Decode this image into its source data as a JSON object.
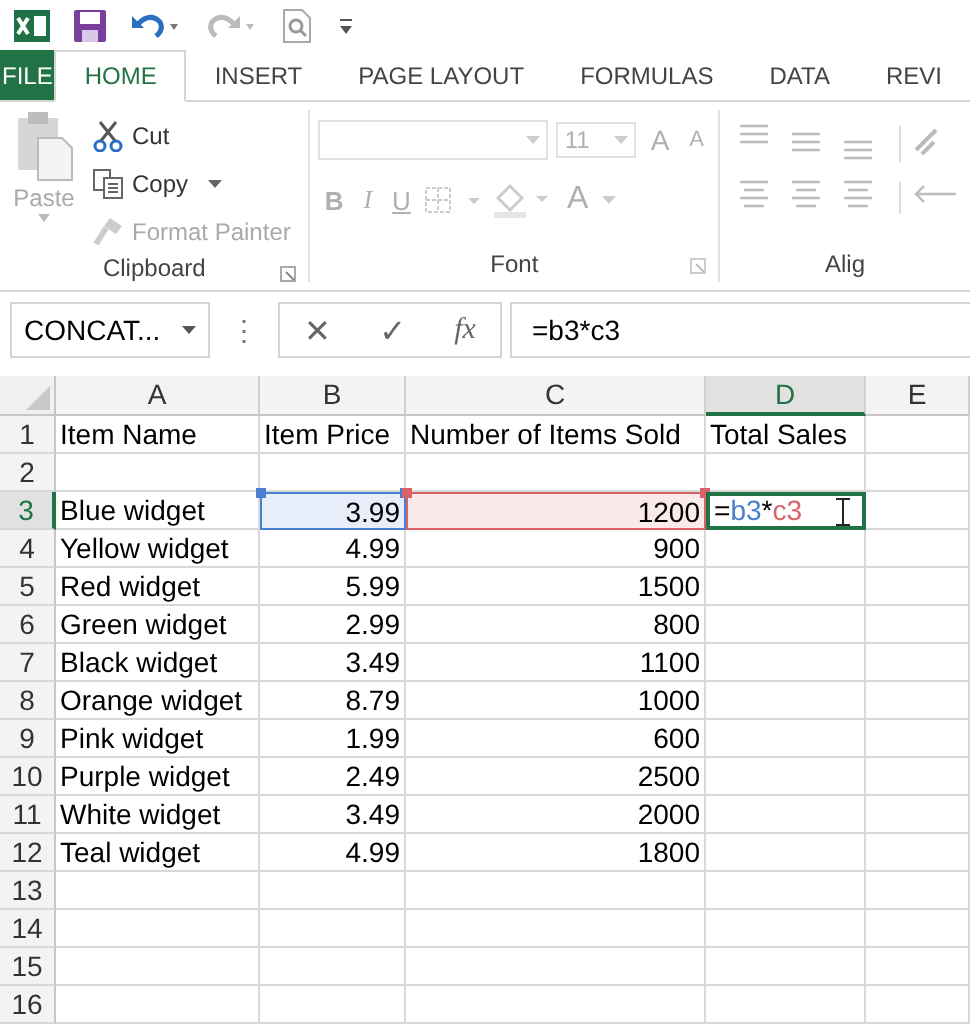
{
  "tabs": [
    {
      "label": "FILE",
      "kind": "file",
      "selected": false
    },
    {
      "label": "HOME",
      "kind": "tab",
      "selected": true
    },
    {
      "label": "INSERT",
      "kind": "tab",
      "selected": false
    },
    {
      "label": "PAGE LAYOUT",
      "kind": "tab",
      "selected": false
    },
    {
      "label": "FORMULAS",
      "kind": "tab",
      "selected": false
    },
    {
      "label": "DATA",
      "kind": "tab",
      "selected": false
    },
    {
      "label": "REVI",
      "kind": "tab",
      "selected": false
    }
  ],
  "ribbon": {
    "clipboard": {
      "title": "Clipboard",
      "paste": {
        "label": "Paste",
        "disabled": true
      },
      "items": [
        {
          "label": "Cut",
          "kind": "cut",
          "disabled": false
        },
        {
          "label": "Copy",
          "kind": "copy",
          "disabled": false
        },
        {
          "label": "Format Painter",
          "kind": "painter",
          "disabled": true
        }
      ]
    },
    "font": {
      "title": "Font",
      "disabled": true,
      "font_size": "11",
      "size_buttons": [
        "A",
        "A"
      ],
      "format_buttons": [
        {
          "label": "B",
          "kind": "bold"
        },
        {
          "label": "I",
          "kind": "italic"
        },
        {
          "label": "U",
          "kind": "underline"
        }
      ],
      "font_color": "A"
    },
    "alignment": {
      "title": "Alig"
    }
  },
  "formula_bar": {
    "name_box": "CONCAT...",
    "separator": "⋮",
    "buttons": [
      "✕",
      "✓",
      "fx"
    ],
    "formula": "=b3*c3"
  },
  "sheet": {
    "columns": [
      {
        "label": "A",
        "selected": false
      },
      {
        "label": "B",
        "selected": false
      },
      {
        "label": "C",
        "selected": false
      },
      {
        "label": "D",
        "selected": true
      },
      {
        "label": "E",
        "selected": false
      }
    ],
    "rows": [
      {
        "number": "1",
        "selected": false,
        "cells": [
          {
            "kind": "text",
            "text": "Item Name"
          },
          {
            "kind": "text",
            "text": "Item Price"
          },
          {
            "kind": "text",
            "text": "Number of Items Sold"
          },
          {
            "kind": "text",
            "text": "Total Sales"
          },
          {
            "kind": "empty"
          }
        ]
      },
      {
        "number": "2",
        "selected": false,
        "cells": [
          {
            "kind": "empty"
          },
          {
            "kind": "empty"
          },
          {
            "kind": "empty"
          },
          {
            "kind": "empty"
          },
          {
            "kind": "empty"
          }
        ]
      },
      {
        "number": "3",
        "selected": true,
        "cells": [
          {
            "kind": "text",
            "text": "Blue widget"
          },
          {
            "kind": "number",
            "text": "3.99",
            "color": "#4a7fd0"
          },
          {
            "kind": "number",
            "text": "1200",
            "color": "#d9626a"
          },
          {
            "kind": "formula",
            "editing": true,
            "parts": [
              {
                "text": "=",
                "color": "#000000"
              },
              {
                "text": "b3",
                "color": "#4a7fd0"
              },
              {
                "text": "*",
                "color": "#000000"
              },
              {
                "text": "c3",
                "color": "#d9626a"
              }
            ]
          },
          {
            "kind": "empty"
          }
        ]
      },
      {
        "number": "4",
        "selected": false,
        "cells": [
          {
            "kind": "text",
            "text": "Yellow widget"
          },
          {
            "kind": "number",
            "text": "4.99"
          },
          {
            "kind": "number",
            "text": "900"
          },
          {
            "kind": "empty"
          },
          {
            "kind": "empty"
          }
        ]
      },
      {
        "number": "5",
        "selected": false,
        "cells": [
          {
            "kind": "text",
            "text": "Red widget"
          },
          {
            "kind": "number",
            "text": "5.99"
          },
          {
            "kind": "number",
            "text": "1500"
          },
          {
            "kind": "empty"
          },
          {
            "kind": "empty"
          }
        ]
      },
      {
        "number": "6",
        "selected": false,
        "cells": [
          {
            "kind": "text",
            "text": "Green widget"
          },
          {
            "kind": "number",
            "text": "2.99"
          },
          {
            "kind": "number",
            "text": "800"
          },
          {
            "kind": "empty"
          },
          {
            "kind": "empty"
          }
        ]
      },
      {
        "number": "7",
        "selected": false,
        "cells": [
          {
            "kind": "text",
            "text": "Black widget"
          },
          {
            "kind": "number",
            "text": "3.49"
          },
          {
            "kind": "number",
            "text": "1100"
          },
          {
            "kind": "empty"
          },
          {
            "kind": "empty"
          }
        ]
      },
      {
        "number": "8",
        "selected": false,
        "cells": [
          {
            "kind": "text",
            "text": "Orange widget"
          },
          {
            "kind": "number",
            "text": "8.79"
          },
          {
            "kind": "number",
            "text": "1000"
          },
          {
            "kind": "empty"
          },
          {
            "kind": "empty"
          }
        ]
      },
      {
        "number": "9",
        "selected": false,
        "cells": [
          {
            "kind": "text",
            "text": "Pink widget"
          },
          {
            "kind": "number",
            "text": "1.99"
          },
          {
            "kind": "number",
            "text": "600"
          },
          {
            "kind": "empty"
          },
          {
            "kind": "empty"
          }
        ]
      },
      {
        "number": "10",
        "selected": false,
        "cells": [
          {
            "kind": "text",
            "text": "Purple widget"
          },
          {
            "kind": "number",
            "text": "2.49"
          },
          {
            "kind": "number",
            "text": "2500"
          },
          {
            "kind": "empty"
          },
          {
            "kind": "empty"
          }
        ]
      },
      {
        "number": "11",
        "selected": false,
        "cells": [
          {
            "kind": "text",
            "text": "White widget"
          },
          {
            "kind": "number",
            "text": "3.49"
          },
          {
            "kind": "number",
            "text": "2000"
          },
          {
            "kind": "empty"
          },
          {
            "kind": "empty"
          }
        ]
      },
      {
        "number": "12",
        "selected": false,
        "cells": [
          {
            "kind": "text",
            "text": "Teal widget"
          },
          {
            "kind": "number",
            "text": "4.99"
          },
          {
            "kind": "number",
            "text": "1800"
          },
          {
            "kind": "empty"
          },
          {
            "kind": "empty"
          }
        ]
      },
      {
        "number": "13",
        "selected": false,
        "cells": [
          {
            "kind": "empty"
          },
          {
            "kind": "empty"
          },
          {
            "kind": "empty"
          },
          {
            "kind": "empty"
          },
          {
            "kind": "empty"
          }
        ]
      },
      {
        "number": "14",
        "selected": false,
        "cells": [
          {
            "kind": "empty"
          },
          {
            "kind": "empty"
          },
          {
            "kind": "empty"
          },
          {
            "kind": "empty"
          },
          {
            "kind": "empty"
          }
        ]
      },
      {
        "number": "15",
        "selected": false,
        "cells": [
          {
            "kind": "empty"
          },
          {
            "kind": "empty"
          },
          {
            "kind": "empty"
          },
          {
            "kind": "empty"
          },
          {
            "kind": "empty"
          }
        ]
      },
      {
        "number": "16",
        "selected": false,
        "cells": [
          {
            "kind": "empty"
          },
          {
            "kind": "empty"
          },
          {
            "kind": "empty"
          },
          {
            "kind": "empty"
          },
          {
            "kind": "empty"
          }
        ]
      }
    ]
  }
}
